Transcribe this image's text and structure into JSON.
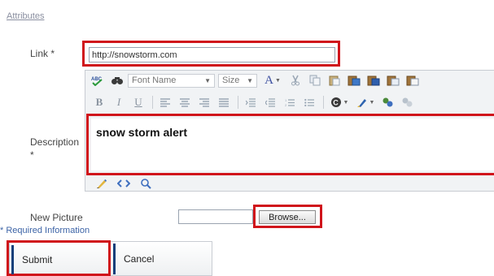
{
  "section": {
    "attributes_link": "Attributes"
  },
  "link": {
    "label": "Link *",
    "value": "http://snowstorm.com"
  },
  "editor": {
    "font_name_label": "Font Name",
    "size_label": "Size",
    "row1_icons": [
      "spellcheck-icon",
      "find-icon",
      "font-color-icon",
      "cut-icon",
      "copy-icon",
      "paste-icon",
      "paste-text-icon",
      "paste-word-icon",
      "paste-html-icon",
      "paste-clipboard-icon"
    ],
    "row2_icons": [
      "bold-icon",
      "italic-icon",
      "underline-icon",
      "align-left-icon",
      "align-center-icon",
      "align-right-icon",
      "justify-icon",
      "indent-icon",
      "outdent-icon",
      "ordered-list-icon",
      "bullet-list-icon",
      "symbol-icon",
      "highlight-icon",
      "link-icon",
      "unlink-icon"
    ]
  },
  "description": {
    "label": "Description",
    "required_mark": "*",
    "value": "snow storm alert"
  },
  "new_picture": {
    "label": "New Picture",
    "browse_label": "Browse..."
  },
  "required_info": "* Required Information",
  "buttons": {
    "submit": "Submit",
    "cancel": "Cancel"
  },
  "colors": {
    "annotation_red": "#d0141b",
    "link_blue": "#3c63a6",
    "button_accent": "#123f7a"
  }
}
